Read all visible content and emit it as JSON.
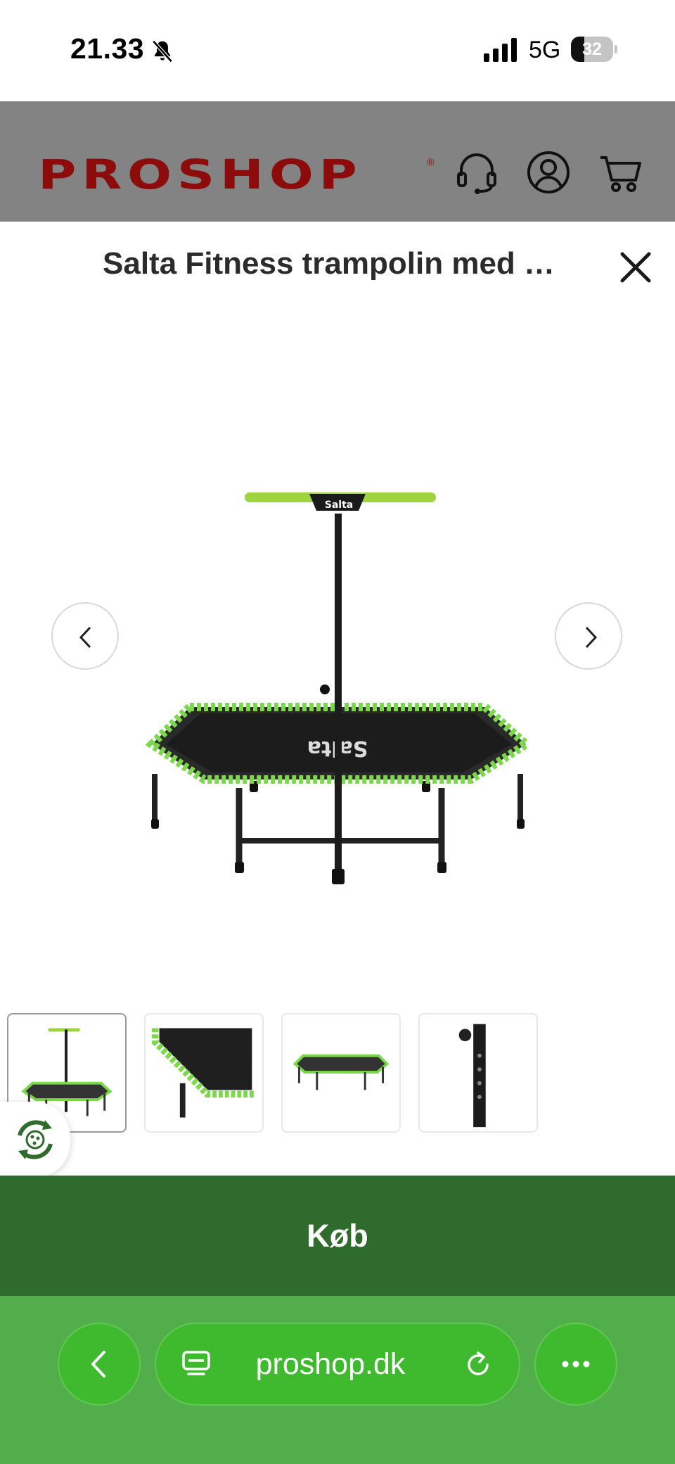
{
  "status_bar": {
    "time": "21.33",
    "network": "5G",
    "battery_level": "32",
    "battery_fraction": 0.32,
    "icons": [
      "bell-slash-icon",
      "cellular-signal-icon",
      "battery-icon"
    ]
  },
  "header": {
    "logo_text": "PROSHOP",
    "logo_mark": "®",
    "brand_color": "#8c0b0b",
    "background": "#838383",
    "icons": [
      "headset-icon",
      "account-icon",
      "cart-icon"
    ]
  },
  "product": {
    "title": "Salta Fitness trampolin med håndtag",
    "image_brand_label": "Salta",
    "accent_color": "#7bd84a",
    "thumbnail_count": 4,
    "active_thumbnail": 1
  },
  "buy_button": {
    "label": "Køb",
    "color": "#2e6b2c"
  },
  "browser": {
    "url": "proshop.dk",
    "bar_color": "#51ae4a",
    "icons": [
      "back-arrow-icon",
      "tabs-icon",
      "reload-icon",
      "more-icon"
    ]
  }
}
